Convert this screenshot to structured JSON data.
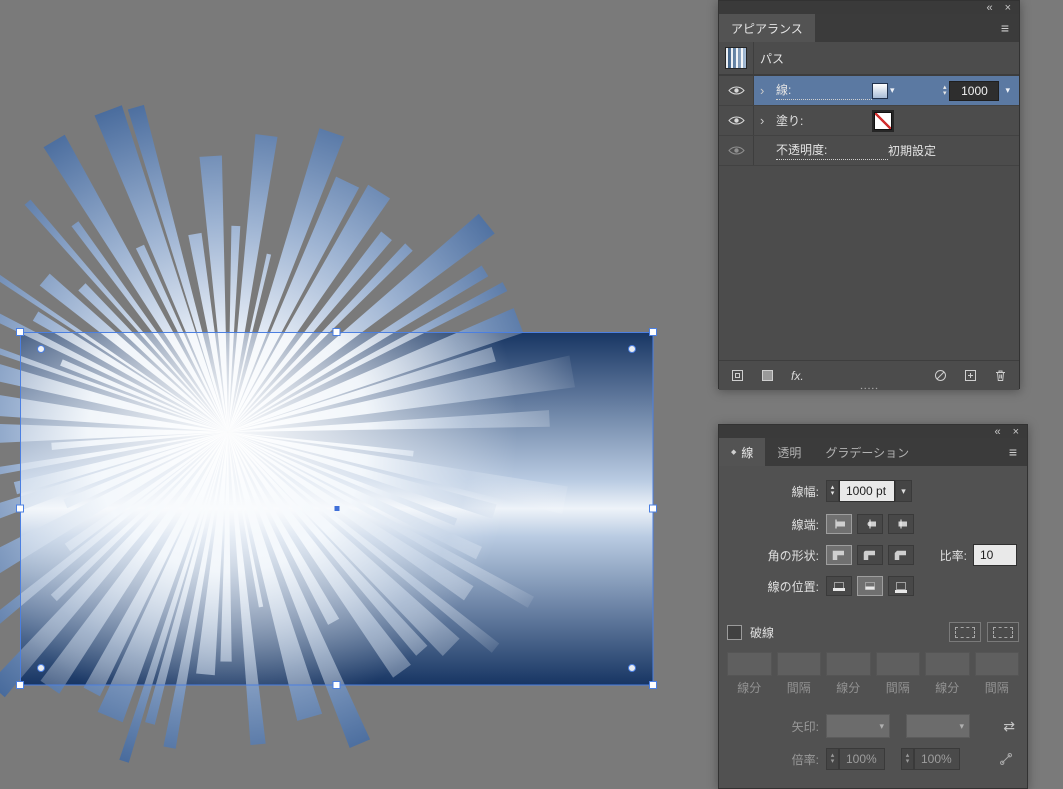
{
  "icons": {
    "collapse": "«",
    "close": "×",
    "menu": "≡",
    "disclosure": "›",
    "chevron_down": "▾",
    "stepper_up": "▴",
    "stepper_down": "▾",
    "tab_diamond": "◆",
    "swap_arrows": "⇄",
    "grip_dots": "▪▪▪▪▪"
  },
  "colors": {
    "canvas_bg": "#7a7a7a",
    "panel_bg": "#4c4c4c",
    "selection_blue": "#4b7fe1",
    "row_highlight": "#5b79a2",
    "ray_blue": "#46699b",
    "fill_none_red": "#d03030"
  },
  "appearance_panel": {
    "tab": "アピアランス",
    "path_row": {
      "label": "パス"
    },
    "stroke_row": {
      "label": "線:",
      "weight": "1000"
    },
    "fill_row": {
      "label": "塗り:"
    },
    "opacity_row": {
      "label": "不透明度:",
      "value": "初期設定"
    },
    "footer": {
      "fx_label": "fx."
    }
  },
  "stroke_panel": {
    "tabs": [
      {
        "label": "線"
      },
      {
        "label": "透明"
      },
      {
        "label": "グラデーション"
      }
    ],
    "weight": {
      "label": "線幅:",
      "value": "1000 pt"
    },
    "cap": {
      "label": "線端:"
    },
    "corner": {
      "label": "角の形状:",
      "limit_label": "比率:",
      "limit_value": "10"
    },
    "align": {
      "label": "線の位置:"
    },
    "dashed": {
      "label": "破線"
    },
    "dash_labels": [
      "線分",
      "間隔",
      "線分",
      "間隔",
      "線分",
      "間隔"
    ],
    "arrow": {
      "label": "矢印:"
    },
    "scale": {
      "label": "倍率:",
      "value_x": "100%",
      "value_y": "100%"
    }
  }
}
